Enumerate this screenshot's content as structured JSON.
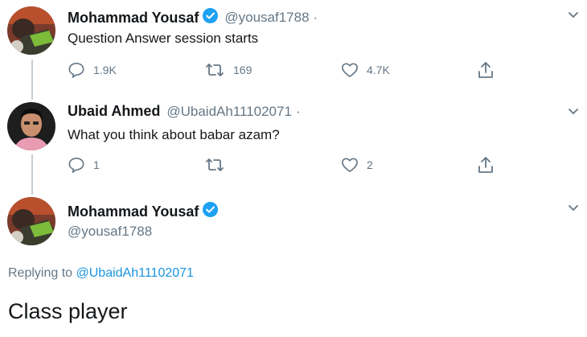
{
  "tweet1": {
    "name": "Mohammad Yousaf",
    "handle": "@yousaf1788",
    "dot": "·",
    "text": "Question Answer session starts",
    "reply_count": "1.9K",
    "retweet_count": "169",
    "like_count": "4.7K"
  },
  "tweet2": {
    "name": "Ubaid Ahmed",
    "handle": "@UbaidAh11102071",
    "dot": "·",
    "text": "What you think about babar azam?",
    "reply_count": "1",
    "retweet_count": "",
    "like_count": "2"
  },
  "tweet3": {
    "name": "Mohammad Yousaf",
    "handle": "@yousaf1788",
    "replying_prefix": "Replying to ",
    "replying_handle": "@UbaidAh11102071",
    "text": "Class player"
  },
  "colors": {
    "verified": "#1da1f2",
    "link": "#1b95e0",
    "muted": "#657786"
  },
  "icons": [
    "reply-icon",
    "retweet-icon",
    "like-icon",
    "share-icon",
    "chevron-down-icon",
    "verified-badge-icon"
  ]
}
